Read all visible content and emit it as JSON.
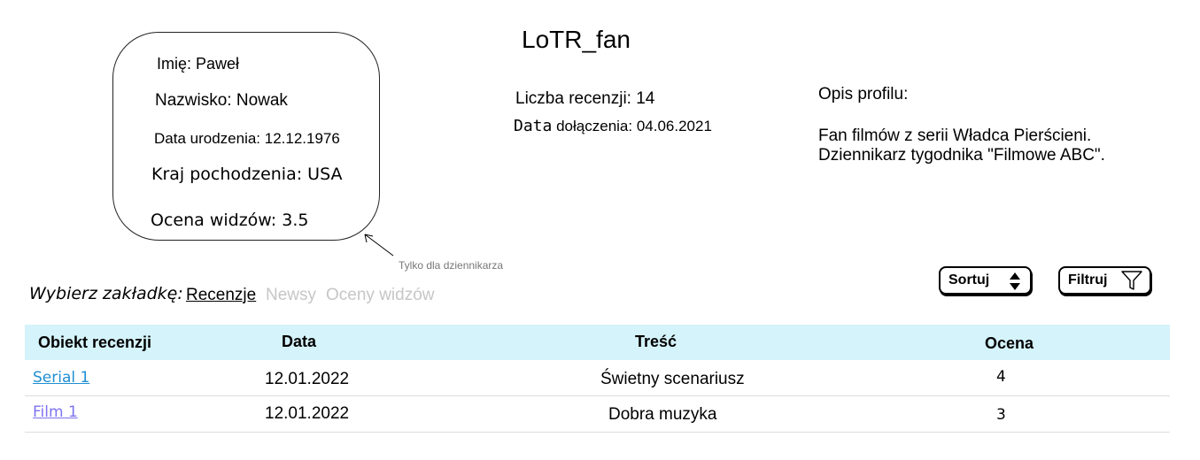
{
  "profile": {
    "first_name": "Imię: Paweł",
    "last_name": "Nazwisko: Nowak",
    "birth_date": "Data urodzenia: 12.12.1976",
    "country": "Kraj pochodzenia: USA",
    "viewer_rating": "Ocena widzów: 3.5",
    "journalist_note": "Tylko dla dziennikarza"
  },
  "user": {
    "username": "LoTR_fan",
    "reviews_count": "Liczba recenzji: 14",
    "join_label": "Data",
    "join_value": "dołączenia: 04.06.2021"
  },
  "description": {
    "label": "Opis profilu:",
    "text": "Fan filmów z serii Władca Pierścieni.\nDziennikarz tygodnika \"Filmowe ABC\"."
  },
  "tabs": {
    "prompt": "Wybierz zakładkę:",
    "items": [
      {
        "label": "Recenzje",
        "active": true
      },
      {
        "label": "Newsy",
        "active": false
      },
      {
        "label": "Oceny widzów",
        "active": false
      }
    ]
  },
  "toolbar": {
    "sort_label": "Sortuj",
    "filter_label": "Filtruj",
    "sort_icon": "sort-updown-icon",
    "filter_icon": "funnel-icon"
  },
  "table": {
    "headers": [
      "Obiekt recenzji",
      "Data",
      "Treść",
      "Ocena"
    ],
    "rows": [
      {
        "object": "Serial 1",
        "date": "12.01.2022",
        "content": "Świetny scenariusz",
        "rating": "4"
      },
      {
        "object": "Film 1",
        "date": "12.01.2022",
        "content": "Dobra muzyka",
        "rating": "3"
      }
    ]
  },
  "colors": {
    "header_bg": "#d4f3fa",
    "link_1": "#1f8fd1",
    "link_2": "#7d73f0",
    "inactive_tab": "#c6c6c6"
  }
}
